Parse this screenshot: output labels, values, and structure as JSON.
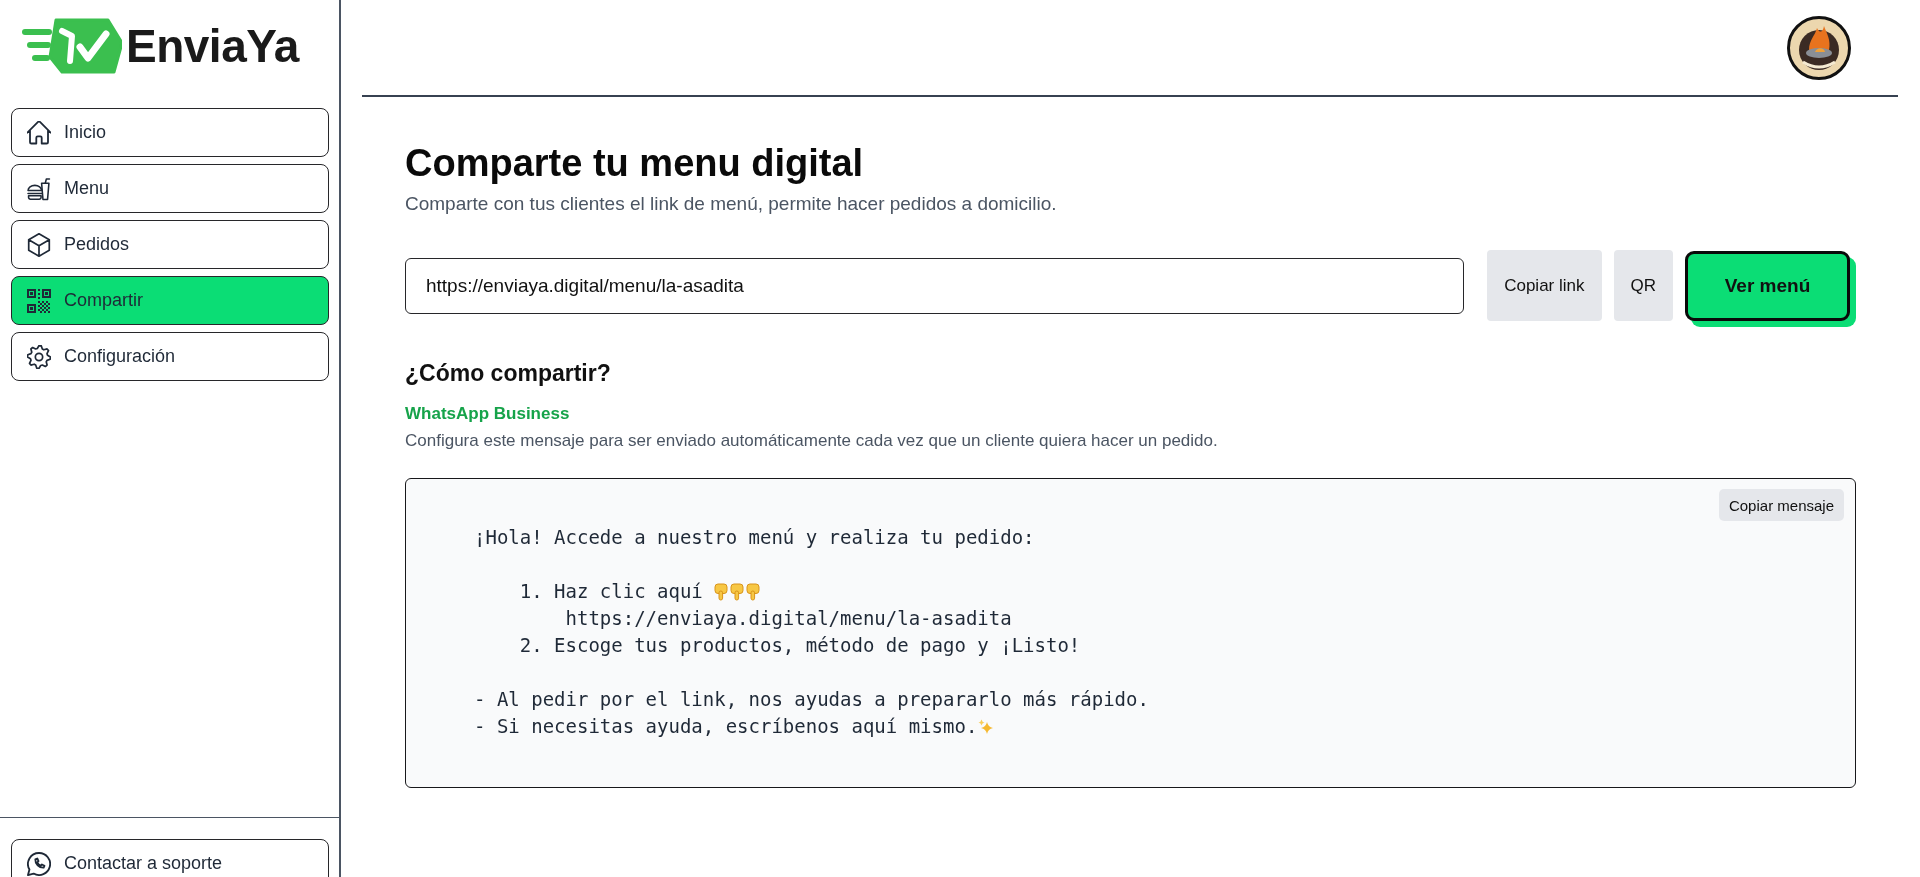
{
  "brand": {
    "name": "EnviaYa"
  },
  "sidebar": {
    "items": [
      {
        "label": "Inicio",
        "selected": false
      },
      {
        "label": "Menu",
        "selected": false
      },
      {
        "label": "Pedidos",
        "selected": false
      },
      {
        "label": "Compartir",
        "selected": true
      },
      {
        "label": "Configuración",
        "selected": false
      }
    ],
    "support": {
      "label": "Contactar a soporte"
    }
  },
  "page": {
    "title": "Comparte tu menu digital",
    "subtitle": "Comparte con tus clientes el link de menú, permite hacer pedidos a domicilio."
  },
  "share": {
    "url": "https://enviaya.digital/menu/la-asadita",
    "buttons": [
      {
        "label": "Copiar link",
        "kind": "secondary"
      },
      {
        "label": "QR",
        "kind": "secondary"
      },
      {
        "label": "Ver menú",
        "kind": "primary"
      }
    ]
  },
  "how_to": {
    "heading": "¿Cómo compartir?",
    "channel": "WhatsApp Business",
    "description": "Configura este mensaje para ser enviado automáticamente cada vez que un cliente quiera hacer un pedido.",
    "message": {
      "copy_button": "Copiar mensaje",
      "lines": [
        {
          "kind": "text",
          "text": "¡Hola! Accede a nuestro menú y realiza tu pedido:"
        },
        {
          "kind": "gap"
        },
        {
          "kind": "pointing",
          "text": "    1. Haz clic aquí"
        },
        {
          "kind": "text",
          "text": "        https://enviaya.digital/menu/la-asadita"
        },
        {
          "kind": "text",
          "text": "    2. Escoge tus productos, método de pago y ¡Listo!"
        },
        {
          "kind": "gap"
        },
        {
          "kind": "text",
          "text": "- Al pedir por el link, nos ayudas a prepararlo más rápido."
        },
        {
          "kind": "sparkle",
          "text": "- Si necesitas ayuda, escríbenos aquí mismo."
        }
      ]
    }
  }
}
